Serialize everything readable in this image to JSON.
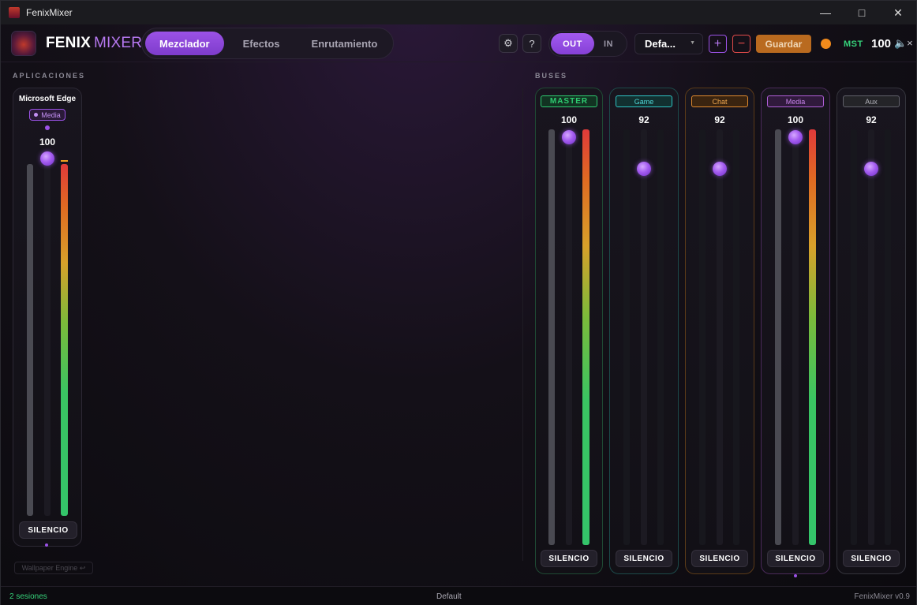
{
  "window": {
    "title": "FenixMixer"
  },
  "header": {
    "brand_primary": "FENIX",
    "brand_secondary": "MIXER",
    "tabs": [
      {
        "label": "Mezclador",
        "active": true
      },
      {
        "label": "Efectos",
        "active": false
      },
      {
        "label": "Enrutamiento",
        "active": false
      }
    ],
    "io": {
      "out_label": "OUT",
      "in_label": "IN",
      "selected": "OUT"
    },
    "preset": "Defa...",
    "save_label": "Guardar",
    "master_label": "MST",
    "master_value": "100"
  },
  "sections": {
    "apps": "APLICACIONES",
    "buses": "BUSES"
  },
  "apps": [
    {
      "name": "Microsoft Edge",
      "bus": "Media",
      "volume": "100",
      "volume_pct": 100,
      "meter_pct": 100,
      "silence_label": "SILENCIO"
    }
  ],
  "ghost_app": {
    "name": "Wallpaper Engine",
    "icon": "return-icon"
  },
  "buses": [
    {
      "name": "MASTER",
      "volume": "100",
      "volume_pct": 100,
      "meter_pct": 100,
      "color": "#2ecc71",
      "silence_label": "SILENCIO"
    },
    {
      "name": "Game",
      "volume": "92",
      "volume_pct": 92,
      "meter_pct": 0,
      "color": "#2ec4c4",
      "silence_label": "SILENCIO"
    },
    {
      "name": "Chat",
      "volume": "92",
      "volume_pct": 92,
      "meter_pct": 0,
      "color": "#e08a2e",
      "silence_label": "SILENCIO"
    },
    {
      "name": "Media",
      "volume": "100",
      "volume_pct": 100,
      "meter_pct": 100,
      "color": "#b05fd8",
      "silence_label": "SILENCIO"
    },
    {
      "name": "Aux",
      "volume": "92",
      "volume_pct": 92,
      "meter_pct": 0,
      "color": "#8a8a92",
      "silence_label": "SILENCIO"
    }
  ],
  "status": {
    "sessions": "2 sesiones",
    "profile": "Default",
    "version": "FenixMixer v0.9"
  },
  "colors": {
    "accent": "#9b52e6",
    "save": "#b96a1f",
    "remove": "#e04a4a",
    "status_dot": "#f08a1c",
    "ok": "#36d27a"
  }
}
